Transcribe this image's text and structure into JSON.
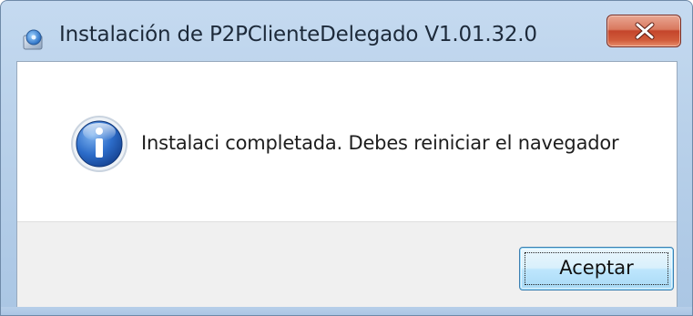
{
  "window": {
    "title": "Instalación de P2PClienteDelegado V1.01.32.0",
    "title_icon": "installer-icon",
    "close_icon": "close-icon"
  },
  "dialog": {
    "icon": "info-icon",
    "message": "Instalaci completada. Debes reiniciar el navegador",
    "ok_label": "Aceptar"
  },
  "colors": {
    "frame": "#b9d1ea",
    "close_button": "#c4452b",
    "footer": "#f0f0f0",
    "info_icon": "#1f5fb8"
  }
}
